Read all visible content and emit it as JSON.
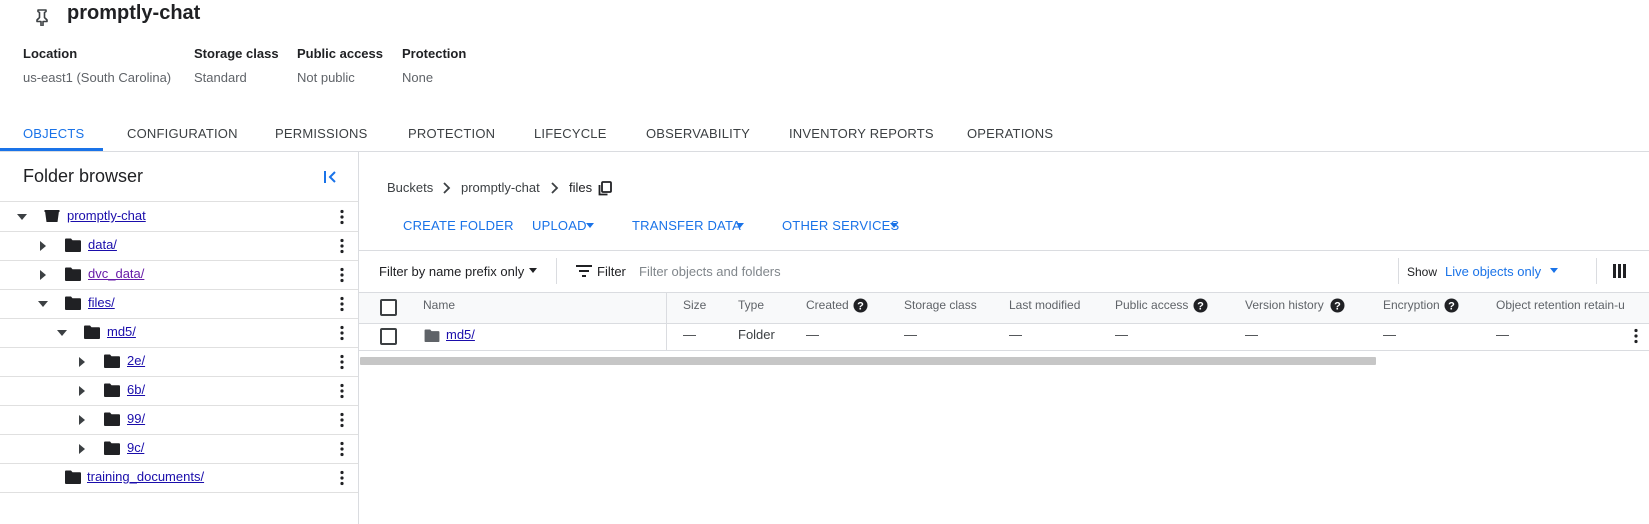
{
  "bucket": {
    "name": "promptly-chat",
    "meta": [
      {
        "label": "Location",
        "value": "us-east1 (South Carolina)"
      },
      {
        "label": "Storage class",
        "value": "Standard"
      },
      {
        "label": "Public access",
        "value": "Not public"
      },
      {
        "label": "Protection",
        "value": "None"
      }
    ]
  },
  "tabs": [
    "OBJECTS",
    "CONFIGURATION",
    "PERMISSIONS",
    "PROTECTION",
    "LIFECYCLE",
    "OBSERVABILITY",
    "INVENTORY REPORTS",
    "OPERATIONS"
  ],
  "active_tab": "OBJECTS",
  "folder_browser": {
    "title": "Folder browser",
    "tree": [
      {
        "label": "promptly-chat",
        "icon": "bucket-icon",
        "toggle": "expanded"
      },
      {
        "label": "data/",
        "icon": "folder-icon",
        "toggle": "collapsed"
      },
      {
        "label": "dvc_data/",
        "icon": "folder-icon",
        "toggle": "collapsed"
      },
      {
        "label": "files/",
        "icon": "folder-icon",
        "toggle": "expanded"
      },
      {
        "label": "md5/",
        "icon": "folder-icon",
        "toggle": "expanded"
      },
      {
        "label": "2e/",
        "icon": "folder-icon",
        "toggle": "collapsed"
      },
      {
        "label": "6b/",
        "icon": "folder-icon",
        "toggle": "collapsed"
      },
      {
        "label": "99/",
        "icon": "folder-icon",
        "toggle": "collapsed"
      },
      {
        "label": "9c/",
        "icon": "folder-icon",
        "toggle": "collapsed"
      },
      {
        "label": "training_documents/",
        "icon": "folder-icon",
        "toggle": "none"
      }
    ]
  },
  "breadcrumb": [
    "Buckets",
    "promptly-chat",
    "files"
  ],
  "actions": {
    "create_folder": "CREATE FOLDER",
    "upload": "UPLOAD",
    "transfer_data": "TRANSFER DATA",
    "other_services": "OTHER SERVICES"
  },
  "filter_bar": {
    "prefix_mode": "Filter by name prefix only",
    "filter_label": "Filter",
    "placeholder": "Filter objects and folders",
    "show_label": "Show",
    "show_value": "Live objects only"
  },
  "table": {
    "columns": [
      "Name",
      "Size",
      "Type",
      "Created",
      "Storage class",
      "Last modified",
      "Public access",
      "Version history",
      "Encryption",
      "Object retention retain-u"
    ],
    "rows": [
      {
        "name": "md5/",
        "size": "—",
        "type": "Folder",
        "created": "—",
        "storage_class": "—",
        "last_modified": "—",
        "public_access": "—",
        "version_history": "—",
        "encryption": "—",
        "retention": "—"
      }
    ]
  },
  "colors": {
    "accent": "#1a73e8",
    "link": "#1a0dab",
    "visited_link": "#681da8",
    "border": "#dadce0",
    "header_bg": "#f8f9fa"
  }
}
